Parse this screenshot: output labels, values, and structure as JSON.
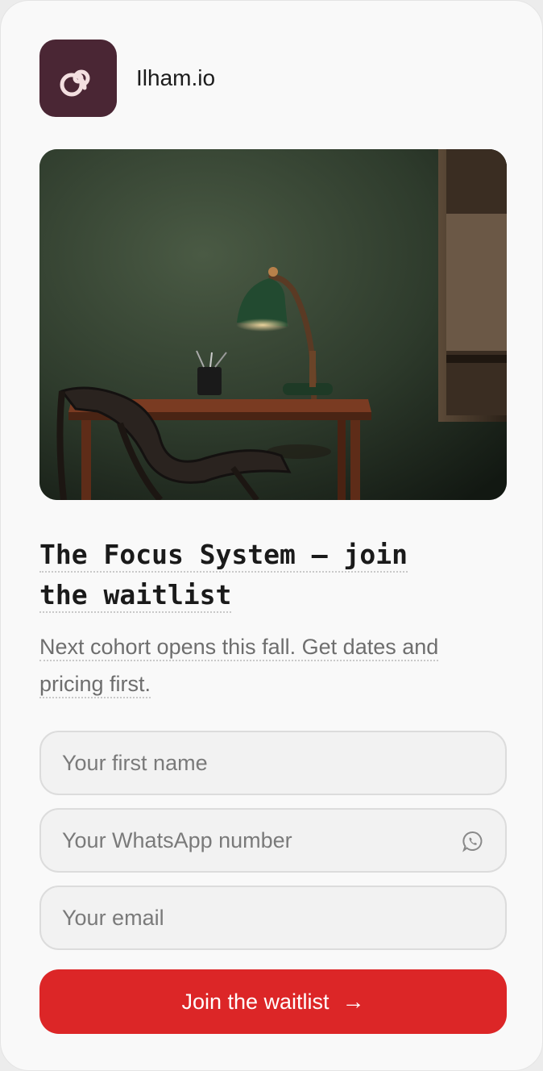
{
  "brand": {
    "name": "Ilham.io",
    "logo_icon": "spiral-icon",
    "logo_color": "#4a2634"
  },
  "hero": {
    "image": "desk-lamp-chair-photo"
  },
  "content": {
    "title_line1": "The Focus System — join",
    "title_line2": "the waitlist",
    "subtitle_line1": "Next cohort opens this fall. Get dates and",
    "subtitle_line2": "pricing first."
  },
  "form": {
    "first_name": {
      "placeholder": "Your first name",
      "value": ""
    },
    "whatsapp": {
      "placeholder": "Your WhatsApp number",
      "value": "",
      "icon": "whatsapp-icon"
    },
    "email": {
      "placeholder": "Your email",
      "value": ""
    },
    "submit_label": "Join the waitlist",
    "submit_icon": "arrow-right-icon",
    "accent_color": "#dc2627"
  }
}
